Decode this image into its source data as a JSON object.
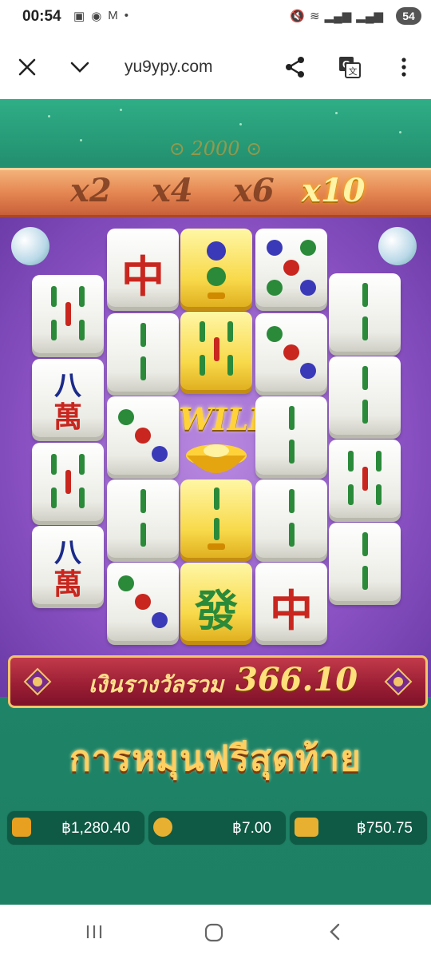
{
  "status_bar": {
    "time": "00:54",
    "battery": "54",
    "icons": [
      "screen-record-icon",
      "chat-icon",
      "gmail-icon",
      "dot-icon",
      "mute-icon",
      "wifi-icon",
      "signal-icon",
      "signal-icon"
    ]
  },
  "browser": {
    "url": "yu9ypy.com",
    "icons": [
      "close-icon",
      "chevron-down-icon",
      "share-icon",
      "translate-icon",
      "more-icon"
    ]
  },
  "game": {
    "top_coin_text": "2000",
    "multipliers": [
      {
        "label": "x2",
        "active": false
      },
      {
        "label": "x4",
        "active": false
      },
      {
        "label": "x6",
        "active": false
      },
      {
        "label": "x10",
        "active": true
      }
    ],
    "wild_label": "WILD",
    "win_banner": {
      "label": "เงินรางวัลรวม",
      "value": "366.10"
    },
    "free_spin_text": "การหมุนฟรีสุดท้าย",
    "stats": {
      "balance": "฿1,280.40",
      "bet": "฿7.00",
      "win": "฿750.75"
    },
    "tiles": {
      "zhong": "中",
      "ba": "八",
      "wan": "萬",
      "fa": "發"
    },
    "colors": {
      "game_green": "#23906f",
      "purple": "#8b52c4",
      "gold": "#f8d94a",
      "banner_red": "#9c1f35"
    }
  },
  "nav": {
    "icons": [
      "recent-apps-icon",
      "home-icon",
      "back-icon"
    ]
  }
}
